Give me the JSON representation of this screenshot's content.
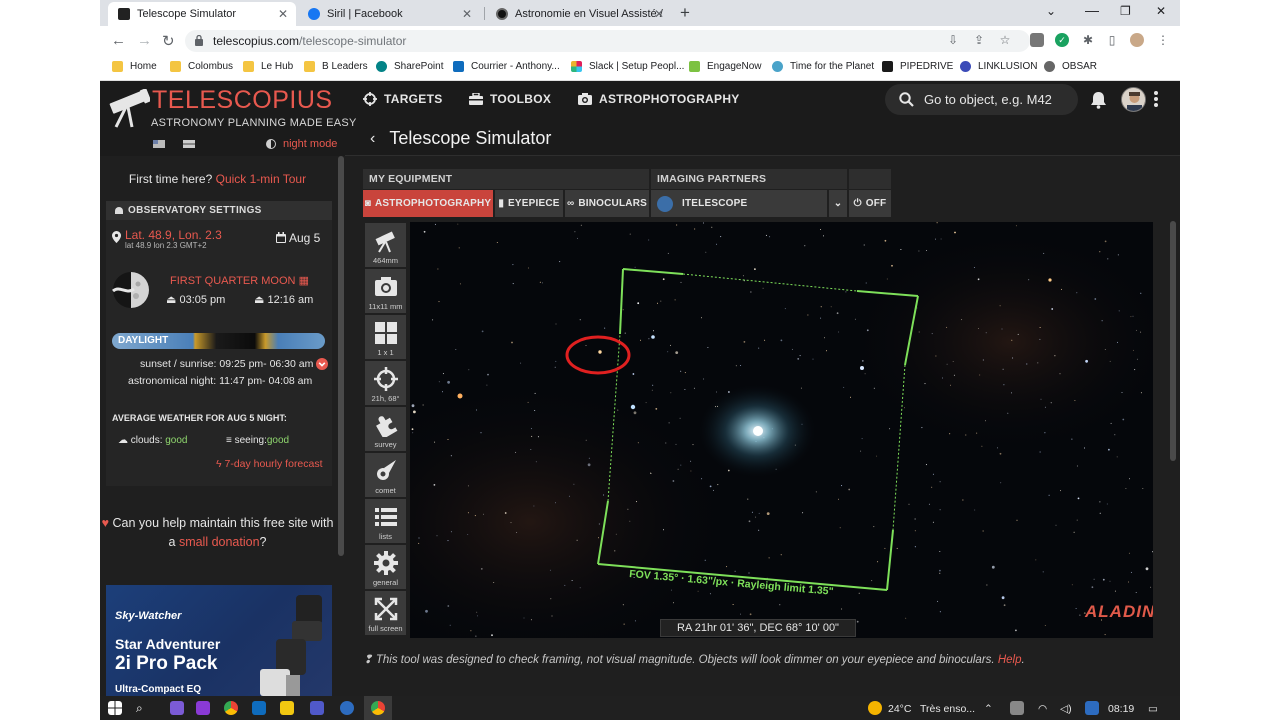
{
  "browser": {
    "tabs": [
      {
        "label": "Telescope Simulator",
        "active": true
      },
      {
        "label": "Siril | Facebook",
        "active": false
      },
      {
        "label": "Astronomie en Visuel Assisté / El",
        "active": false
      }
    ],
    "url_host": "telescopius.com",
    "url_path": "/telescope-simulator",
    "bookmarks": [
      "Home",
      "Colombus",
      "Le Hub",
      "B Leaders",
      "SharePoint",
      "Courrier - Anthony...",
      "Slack | Setup Peopl...",
      "EngageNow",
      "Time for the Planet",
      "PIPEDRIVE",
      "LINKLUSION",
      "OBSAR"
    ]
  },
  "header": {
    "logo_title": "TELESCOPIUS",
    "logo_subtitle": "ASTRONOMY PLANNING MADE EASY",
    "night_mode": "night mode",
    "nav": [
      "TARGETS",
      "TOOLBOX",
      "ASTROPHOTOGRAPHY"
    ],
    "search_placeholder": "Go to object, e.g. M42"
  },
  "page_title": "Telescope Simulator",
  "sidebar": {
    "tour_prefix": "First time here?",
    "tour_link": "Quick 1-min Tour",
    "observatory_heading": "OBSERVATORY SETTINGS",
    "location": "Lat. 48.9, Lon. 2.3",
    "location_detail": "lat 48.9  lon 2.3  GMT+2",
    "date": "Aug 5",
    "moon_phase": "FIRST QUARTER MOON",
    "moonrise": "03:05 pm",
    "moonset": "12:16 am",
    "daylight_label": "DAYLIGHT",
    "sunset_row_label": "sunset / sunrise:",
    "sunset_row_value": "09:25 pm- 06:30 am",
    "astro_row_label": "astronomical night:",
    "astro_row_value": "11:47 pm- 04:08 am",
    "weather_heading": "AVERAGE WEATHER FOR AUG 5 NIGHT:",
    "clouds_label": "clouds:",
    "clouds_value": "good",
    "seeing_label": "seeing:",
    "seeing_value": "good",
    "forecast_link": "7-day hourly forecast",
    "donation_text": "Can you help maintain this free site with a",
    "donation_link": "small donation",
    "donation_end": "?",
    "ad": {
      "brand": "Sky-Watcher",
      "line1": "Star Adventurer",
      "line2": "2i Pro Pack",
      "line3": "Ultra-Compact EQ"
    }
  },
  "equipment": {
    "my_equipment_heading": "MY EQUIPMENT",
    "imaging_partners_heading": "IMAGING PARTNERS",
    "tabs": [
      "ASTROPHOTOGRAPHY",
      "EYEPIECE",
      "BINOCULARS"
    ],
    "partner": "ITELESCOPE",
    "off_label": "OFF"
  },
  "tools": [
    {
      "name": "telescope",
      "label": "464mm"
    },
    {
      "name": "camera",
      "label": "11x11 mm"
    },
    {
      "name": "mosaic",
      "label": "1 x 1"
    },
    {
      "name": "target",
      "label": "21h, 68°"
    },
    {
      "name": "survey",
      "label": "survey"
    },
    {
      "name": "comet",
      "label": "comet"
    },
    {
      "name": "lists",
      "label": "lists"
    },
    {
      "name": "general",
      "label": "general"
    },
    {
      "name": "fullscreen",
      "label": "full screen"
    }
  ],
  "sky": {
    "fov_label": "FOV 1.35° · 1.63\"/px · Rayleigh limit 1.35\"",
    "radec": "RA 21hr 01' 36\", DEC 68° 10' 00\"",
    "aladin": "ALADIN"
  },
  "note": {
    "text": "This tool was designed to check framing, not visual magnitude. Objects will look dimmer on your eyepiece and binoculars.",
    "link": "Help"
  },
  "taskbar": {
    "temperature": "24°C",
    "weather": "Très enso...",
    "time": "08:19"
  },
  "colors": {
    "accent": "#e8594f",
    "fov_frame": "#7ee05a",
    "selected_tab": "#c9443c",
    "annotation_circle": "#e02020"
  }
}
